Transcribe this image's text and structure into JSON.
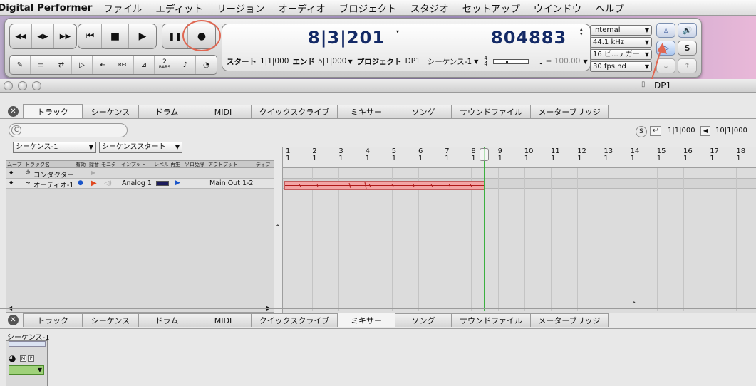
{
  "menubar": {
    "app": "Digital Performer",
    "items": [
      "ファイル",
      "エディット",
      "リージョン",
      "オーディオ",
      "プロジェクト",
      "スタジオ",
      "セットアップ",
      "ウインドウ",
      "ヘルプ"
    ]
  },
  "transport": {
    "main_buttons": [
      {
        "name": "rewind-button",
        "glyph": "◀◀"
      },
      {
        "name": "scrub-button",
        "glyph": "◀▶"
      },
      {
        "name": "fast-forward-button",
        "glyph": "▶▶"
      }
    ],
    "play_buttons": [
      {
        "name": "go-to-start-button",
        "glyph": "⏮"
      },
      {
        "name": "stop-button",
        "glyph": "■"
      },
      {
        "name": "play-button",
        "glyph": "▶"
      }
    ],
    "rec_buttons": [
      {
        "name": "pause-button",
        "glyph": "❚❚"
      },
      {
        "name": "record-button",
        "glyph": "●"
      }
    ],
    "small_buttons": [
      {
        "name": "punch-button",
        "glyph": "✎"
      },
      {
        "name": "memory-cycle-button",
        "glyph": "▭"
      },
      {
        "name": "overdub-button",
        "glyph": "⇄"
      },
      {
        "name": "auto-rewind-button",
        "glyph": "▷"
      },
      {
        "name": "auto-stop-button",
        "glyph": "⇤"
      },
      {
        "name": "rec-button",
        "glyph": "REC"
      },
      {
        "name": "countoff-button",
        "glyph": "⊿"
      },
      {
        "name": "bars-button",
        "glyph": "2"
      },
      {
        "name": "metronome-button",
        "glyph": "♪"
      },
      {
        "name": "clock-button",
        "glyph": "◔"
      }
    ],
    "bars_label": "BARS",
    "counter_main": "8|3|201",
    "counter_samples": "804883",
    "start_label": "スタート",
    "start_value": "1|1|000",
    "end_label": "エンド",
    "end_value": "5|1|000",
    "project_label": "プロジェクト",
    "project_value": "DP1",
    "sequence_value": "シーケンス-1",
    "meter_top": "4",
    "meter_bottom": "4",
    "tempo_value": "= 100.00",
    "sync_select": "Internal",
    "rate_select": "44.1 kHz",
    "bits_select": "16 ビ…テガー",
    "fps_select": "30 fps nd",
    "right_buttons": [
      "🔊",
      "S"
    ]
  },
  "window": {
    "title": "DP1"
  },
  "tabs_top": [
    "トラック",
    "シーケンス",
    "ドラム",
    "MIDI",
    "クイックスクライブ",
    "ミキサー",
    "ソング",
    "サウンドファイル",
    "メーターブリッジ"
  ],
  "tabs_top_active": 0,
  "search": {
    "placeholder": "C"
  },
  "sequence_menu": {
    "sequence": "シーケンス-1",
    "start": "シーケンススタート"
  },
  "track_columns": [
    "ムーブ",
    "トラック名",
    "有効",
    "録音",
    "モニタ",
    "インプット",
    "レベル",
    "再生",
    "ソロ免除",
    "アウトプット",
    "ディフ"
  ],
  "tracks": [
    {
      "name": "コンダクター",
      "input": "",
      "output": ""
    },
    {
      "name": "オーディオ-1",
      "input": "Analog 1",
      "output": "Main Out 1-2"
    }
  ],
  "ruler": {
    "bars": [
      "1",
      "2",
      "3",
      "4",
      "5",
      "6",
      "7",
      "8",
      "9",
      "10",
      "11",
      "12",
      "13",
      "14",
      "15",
      "16",
      "17",
      "18"
    ],
    "beats": "1"
  },
  "locator": {
    "s_label": "S",
    "start": "1|1|000",
    "end": "10|1|000"
  },
  "tabs_bottom_active": 5,
  "mixer": {
    "sequence": "シーケンス-1",
    "m": "M",
    "p": "P"
  }
}
